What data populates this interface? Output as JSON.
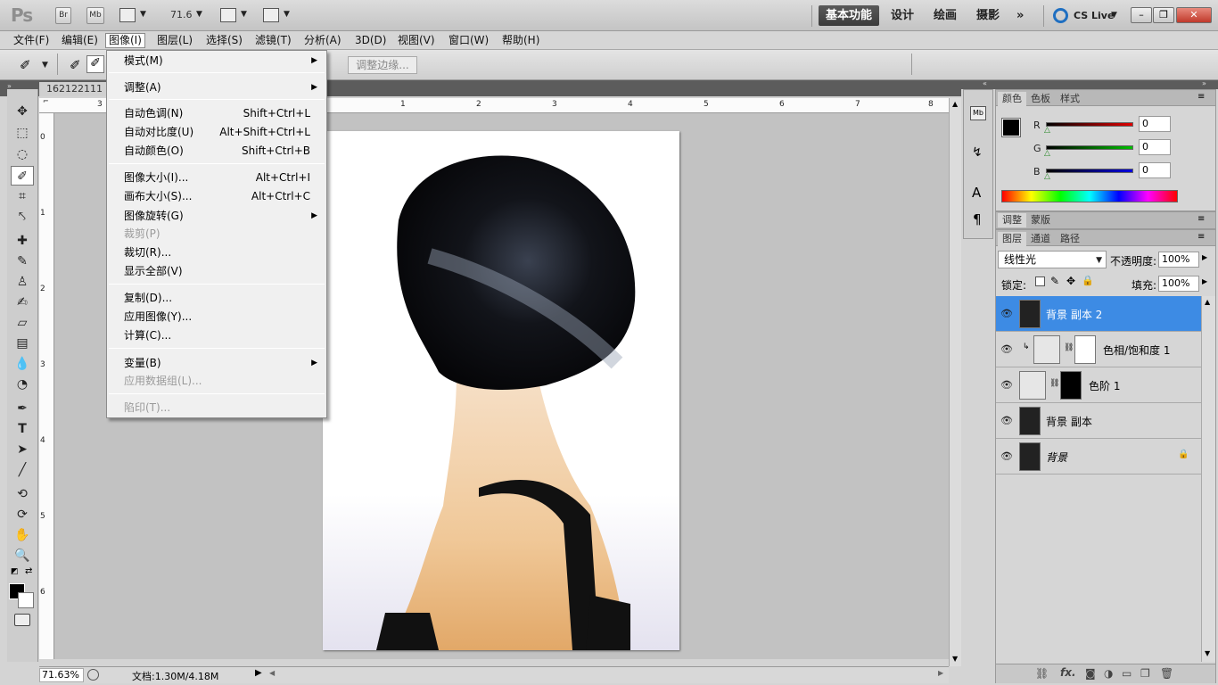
{
  "app": {
    "logo": "Ps",
    "bridge_btn": "Br",
    "minibridge_btn": "Mb",
    "zoom": "71.6",
    "workspaces": [
      "基本功能",
      "设计",
      "绘画",
      "摄影"
    ],
    "more": "»",
    "cslive": "CS Live"
  },
  "menubar": [
    "文件(F)",
    "编辑(E)",
    "图像(I)",
    "图层(L)",
    "选择(S)",
    "滤镜(T)",
    "分析(A)",
    "3D(D)",
    "视图(V)",
    "窗口(W)",
    "帮助(H)"
  ],
  "options": {
    "refine_edge": "调整边缘..."
  },
  "document": {
    "tab": "162122111",
    "zoom_status": "71.63%",
    "doc_info": "文档:1.30M/4.18M"
  },
  "ruler_top": [
    "1",
    "2",
    "3",
    "4",
    "5",
    "6",
    "7",
    "8",
    "3"
  ],
  "ruler_left": [
    "0",
    "1",
    "2",
    "3",
    "4",
    "5",
    "6"
  ],
  "image_menu": {
    "mode": "模式(M)",
    "adjustments": "调整(A)",
    "auto_tone": {
      "label": "自动色调(N)",
      "shortcut": "Shift+Ctrl+L"
    },
    "auto_contrast": {
      "label": "自动对比度(U)",
      "shortcut": "Alt+Shift+Ctrl+L"
    },
    "auto_color": {
      "label": "自动颜色(O)",
      "shortcut": "Shift+Ctrl+B"
    },
    "image_size": {
      "label": "图像大小(I)...",
      "shortcut": "Alt+Ctrl+I"
    },
    "canvas_size": {
      "label": "画布大小(S)...",
      "shortcut": "Alt+Ctrl+C"
    },
    "rotation": "图像旋转(G)",
    "crop": "裁剪(P)",
    "trim": "裁切(R)...",
    "reveal_all": "显示全部(V)",
    "duplicate": "复制(D)...",
    "apply_image": "应用图像(Y)...",
    "calculations": "计算(C)...",
    "variables": "变量(B)",
    "apply_dataset": "应用数据组(L)...",
    "trap": "陷印(T)..."
  },
  "color_panel": {
    "tabs": [
      "颜色",
      "色板",
      "样式"
    ],
    "r_label": "R",
    "g_label": "G",
    "b_label": "B",
    "r": "0",
    "g": "0",
    "b": "0",
    "colors": {
      "r": "#e00000",
      "g": "#00c000",
      "b": "#0000e0"
    }
  },
  "adj_panel": {
    "tabs": [
      "调整",
      "蒙版"
    ]
  },
  "layers_panel": {
    "tabs": [
      "图层",
      "通道",
      "路径"
    ],
    "blend_mode": "线性光",
    "opacity_label": "不透明度:",
    "opacity": "100%",
    "lock_label": "锁定:",
    "fill_label": "填充:",
    "fill": "100%",
    "layers": [
      {
        "name": "背景 副本 2"
      },
      {
        "name": "色相/饱和度 1"
      },
      {
        "name": "色阶 1"
      },
      {
        "name": "背景 副本"
      },
      {
        "name": "背景"
      }
    ]
  }
}
